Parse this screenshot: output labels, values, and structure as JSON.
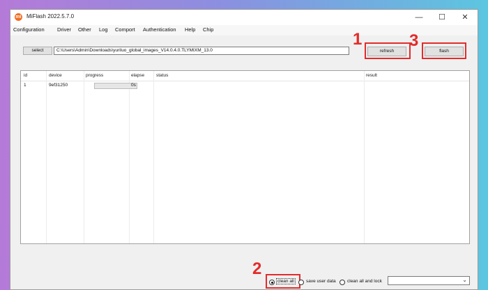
{
  "window": {
    "title": "MiFlash 2022.5.7.0",
    "icon": "mi-logo-icon",
    "controls": {
      "minimize": "—",
      "maximize": "☐",
      "close": "✕"
    }
  },
  "menu": [
    "Configuration",
    "Driver",
    "Other",
    "Log",
    "Comport",
    "Authentication",
    "Help",
    "Chip"
  ],
  "toolbar": {
    "select_label": "select",
    "path_value": "C:\\Users\\Admin\\Downloads\\yuriluo_global_images_V14.0.4.0.TLYMIXM_13.0",
    "refresh_label": "refresh",
    "flash_label": "flash"
  },
  "annotations": {
    "step1": "1",
    "step2": "2",
    "step3": "3",
    "color": "#e32b2b"
  },
  "grid": {
    "columns": [
      "id",
      "device",
      "progress",
      "elapse",
      "status",
      "result"
    ],
    "rows": [
      {
        "id": "1",
        "device": "9ef31250",
        "progress": 0,
        "elapse": "0s",
        "status": "",
        "result": ""
      }
    ]
  },
  "flash_options": {
    "options": [
      "clean all",
      "save user data",
      "clean all and lock"
    ],
    "selected": "clean all",
    "dropdown_value": ""
  }
}
